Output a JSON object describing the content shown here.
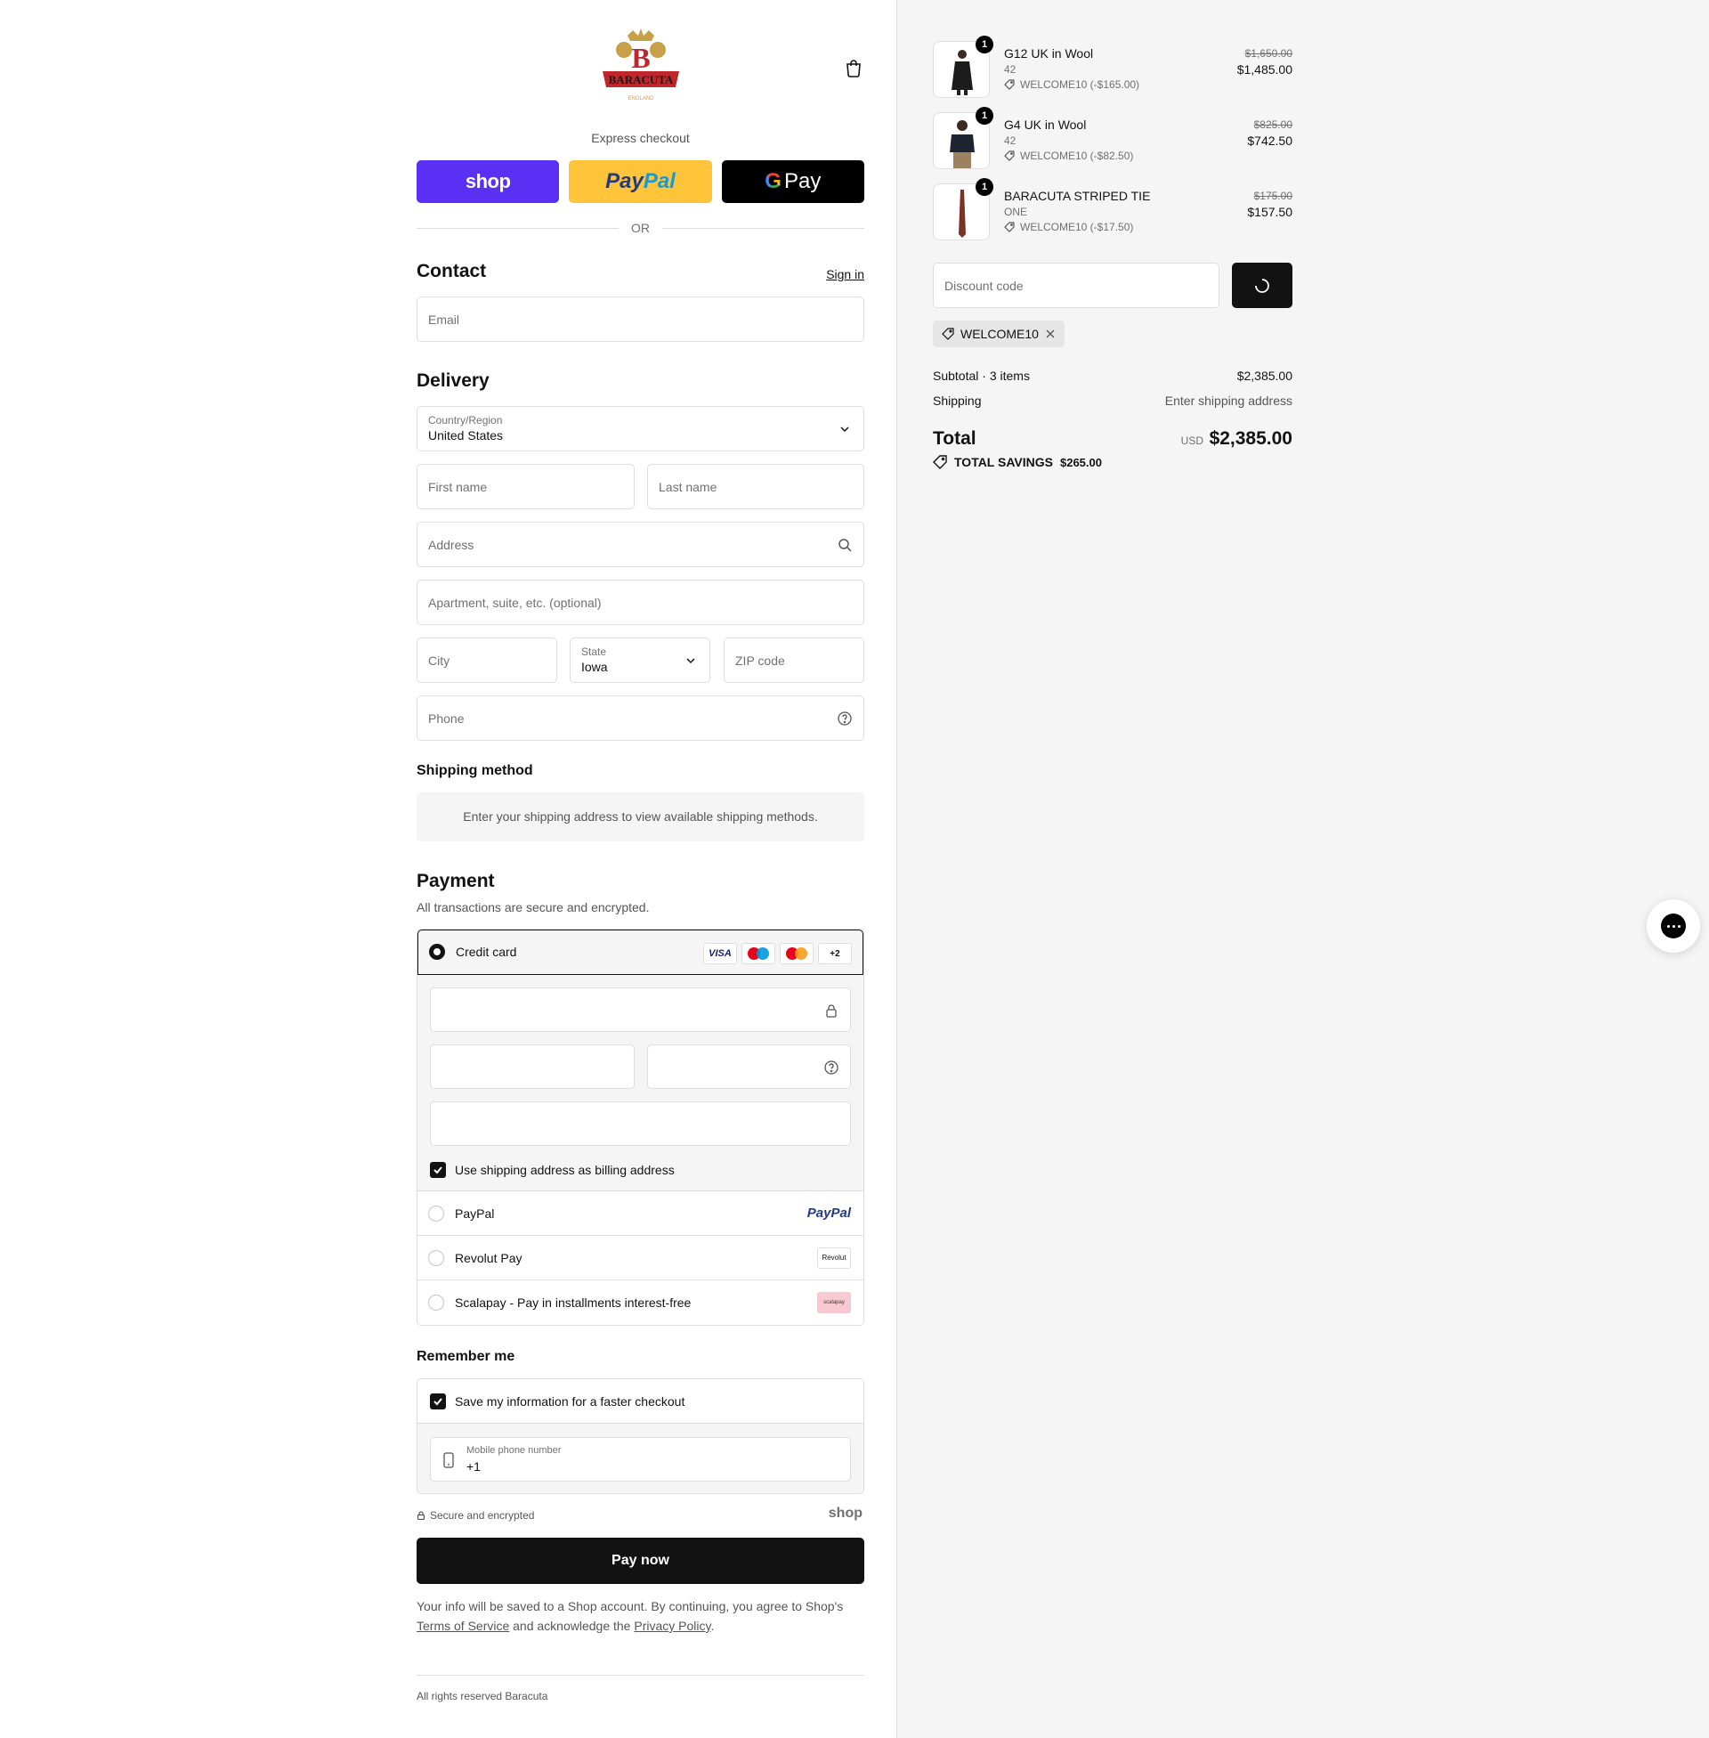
{
  "brand": {
    "name": "BARACUTA",
    "subtitle": "ENGLAND"
  },
  "express": {
    "label": "Express checkout",
    "shop_label": "shop",
    "paypal_part1": "Pay",
    "paypal_part2": "Pal",
    "gpay_label": "Pay",
    "or_label": "OR"
  },
  "contact": {
    "title": "Contact",
    "signin_label": "Sign in",
    "email_placeholder": "Email"
  },
  "delivery": {
    "title": "Delivery",
    "country_label": "Country/Region",
    "country_value": "United States",
    "first_name_placeholder": "First name",
    "last_name_placeholder": "Last name",
    "address_placeholder": "Address",
    "apartment_placeholder": "Apartment, suite, etc. (optional)",
    "city_placeholder": "City",
    "state_label": "State",
    "state_value": "Iowa",
    "zip_placeholder": "ZIP code",
    "phone_placeholder": "Phone"
  },
  "shipping_method": {
    "title": "Shipping method",
    "info": "Enter your shipping address to view available shipping methods."
  },
  "payment": {
    "title": "Payment",
    "description": "All transactions are secure and encrypted.",
    "credit_card_label": "Credit card",
    "card_brands": [
      "VISA",
      "+2"
    ],
    "billing_checkbox_label": "Use shipping address as billing address",
    "options": [
      {
        "label": "PayPal",
        "logo": "PayPal"
      },
      {
        "label": "Revolut Pay",
        "logo": "Revolut"
      },
      {
        "label": "Scalapay - Pay in installments interest-free",
        "logo": "scalapay"
      }
    ]
  },
  "remember": {
    "title": "Remember me",
    "save_label": "Save my information for a faster checkout",
    "mobile_label": "Mobile phone number",
    "mobile_value": "+1"
  },
  "secure": {
    "label": "Secure and encrypted",
    "shop_logo": "shop"
  },
  "pay_now_label": "Pay now",
  "legal": {
    "text1": "Your info will be saved to a Shop account. By continuing, you agree to Shop's",
    "terms_link": "Terms of Service",
    "text2": "and acknowledge the",
    "privacy_link": "Privacy Policy",
    "text3": "."
  },
  "footer": "All rights reserved Baracuta",
  "order": {
    "items": [
      {
        "qty": "1",
        "name": "G12 UK in Wool",
        "variant": "42",
        "discount": "WELCOME10 (-$165.00)",
        "original_price": "$1,650.00",
        "price": "$1,485.00"
      },
      {
        "qty": "1",
        "name": "G4 UK in Wool",
        "variant": "42",
        "discount": "WELCOME10 (-$82.50)",
        "original_price": "$825.00",
        "price": "$742.50"
      },
      {
        "qty": "1",
        "name": "BARACUTA STRIPED TIE",
        "variant": "ONE",
        "discount": "WELCOME10 (-$17.50)",
        "original_price": "$175.00",
        "price": "$157.50"
      }
    ],
    "discount_placeholder": "Discount code",
    "applied_code": "WELCOME10",
    "subtotal_label": "Subtotal · 3 items",
    "subtotal_value": "$2,385.00",
    "shipping_label": "Shipping",
    "shipping_value": "Enter shipping address",
    "total_label": "Total",
    "total_currency": "USD",
    "total_value": "$2,385.00",
    "savings_label": "TOTAL SAVINGS",
    "savings_value": "$265.00"
  },
  "colors": {
    "shop_purple": "#5a31f4",
    "paypal_yellow": "#ffc439",
    "dark": "#121212",
    "sidebar_bg": "#f5f5f5"
  }
}
